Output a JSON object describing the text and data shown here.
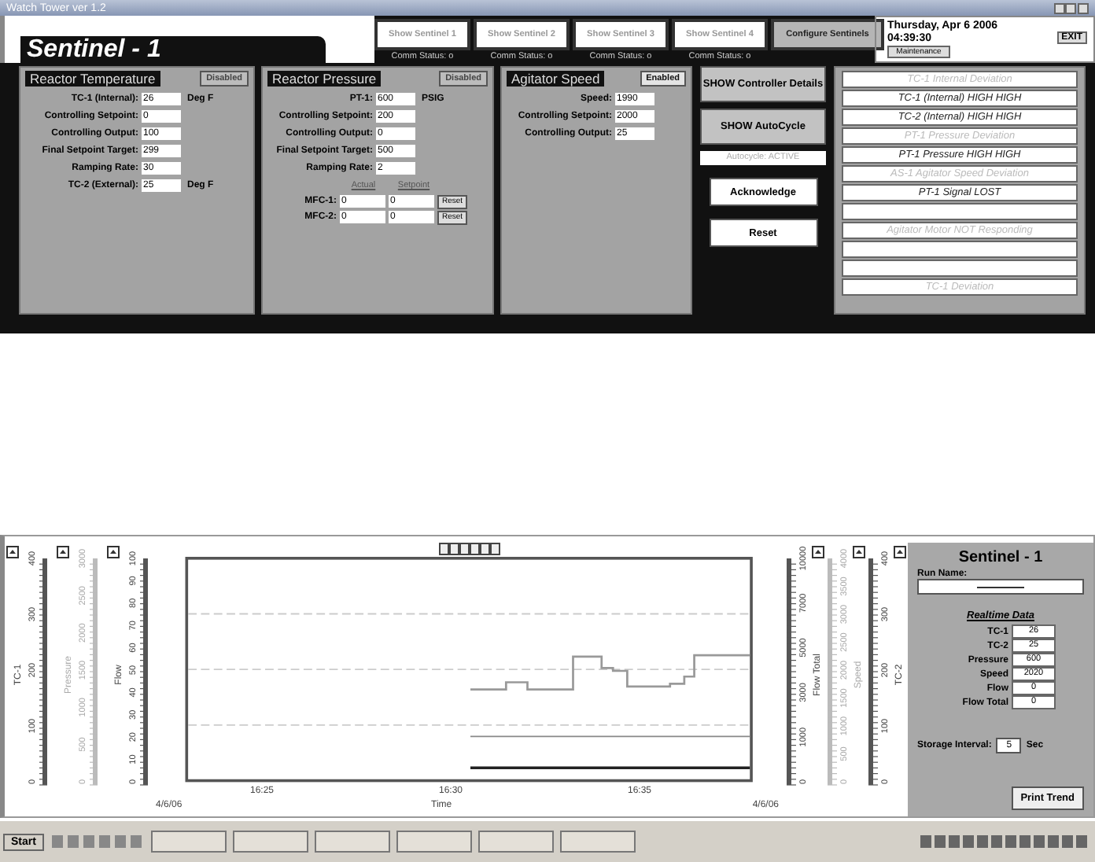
{
  "window": {
    "title": "Watch Tower ver 1.2"
  },
  "sentinel_tab": "Sentinel - 1",
  "sentinel_buttons": [
    {
      "label": "Show Sentinel 1",
      "status": "Comm Status: o",
      "kind": "sentinel"
    },
    {
      "label": "Show Sentinel 2",
      "status": "Comm Status: o",
      "kind": "sentinel"
    },
    {
      "label": "Show Sentinel 3",
      "status": "Comm Status: o",
      "kind": "sentinel"
    },
    {
      "label": "Show Sentinel 4",
      "status": "Comm Status: o",
      "kind": "sentinel"
    },
    {
      "label": "Configure Sentinels",
      "kind": "configure"
    }
  ],
  "clock": {
    "date": "Thursday, Apr 6 2006",
    "time": "04:39:30",
    "exit": "EXIT",
    "maintenance": "Maintenance"
  },
  "panels": [
    {
      "title": "Reactor Temperature",
      "toggle": "Disabled",
      "enabled": false,
      "fields": [
        {
          "label": "TC-1 (Internal):",
          "value": "26",
          "unit": "Deg F"
        },
        {
          "label": "Controlling Setpoint:",
          "value": "0"
        },
        {
          "label": "Controlling Output:",
          "value": "100"
        },
        {
          "label": "Final Setpoint Target:",
          "value": "299"
        },
        {
          "label": "Ramping Rate:",
          "value": "30"
        },
        {
          "label": "TC-2 (External):",
          "value": "25",
          "unit": "Deg F"
        }
      ]
    },
    {
      "title": "Reactor Pressure",
      "toggle": "Disabled",
      "enabled": false,
      "fields": [
        {
          "label": "PT-1:",
          "value": "600",
          "unit": "PSIG"
        },
        {
          "label": "Controlling Setpoint:",
          "value": "200"
        },
        {
          "label": "Controlling Output:",
          "value": "0"
        },
        {
          "label": "Final Setpoint Target:",
          "value": "500"
        },
        {
          "label": "Ramping Rate:",
          "value": "2"
        }
      ],
      "mfc": {
        "headers": [
          "Actual",
          "Setpoint"
        ],
        "rows": [
          {
            "label": "MFC-1:",
            "actual": "0",
            "setpoint": "0",
            "button": "Reset"
          },
          {
            "label": "MFC-2:",
            "actual": "0",
            "setpoint": "0",
            "button": "Reset"
          }
        ]
      }
    },
    {
      "title": "Agitator Speed",
      "toggle": "Enabled",
      "enabled": true,
      "fields": [
        {
          "label": "Speed:",
          "value": "1990"
        },
        {
          "label": "Controlling Setpoint:",
          "value": "2000"
        },
        {
          "label": "Controlling Output:",
          "value": "25"
        }
      ]
    }
  ],
  "controls": {
    "details": "SHOW Controller Details",
    "autocycle": "SHOW AutoCycle",
    "autocycle_status": "Autocycle: ACTIVE",
    "acknowledge": "Acknowledge",
    "reset": "Reset"
  },
  "alarms": [
    {
      "kind": "alarm",
      "text": "TC-1 Internal Deviation",
      "active": false
    },
    {
      "kind": "alarm",
      "text": "TC-1 (Internal) HIGH HIGH",
      "active": true
    },
    {
      "kind": "alarm",
      "text": "TC-2 (Internal) HIGH HIGH",
      "active": true
    },
    {
      "kind": "alarm",
      "text": "PT-1 Pressure Deviation",
      "active": false
    },
    {
      "kind": "alarm",
      "text": "PT-1 Pressure HIGH HIGH",
      "active": true
    },
    {
      "kind": "alarm",
      "text": "AS-1 Agitator Speed Deviation",
      "active": false
    },
    {
      "kind": "alarm",
      "text": "PT-1 Signal LOST",
      "active": true
    },
    {
      "kind": "blank"
    },
    {
      "kind": "alarm",
      "text": "Agitator Motor NOT Responding",
      "active": false
    },
    {
      "kind": "blank"
    },
    {
      "kind": "blank"
    },
    {
      "kind": "alarm",
      "text": "TC-1 Deviation",
      "active": false
    }
  ],
  "trend": {
    "left_axes": [
      {
        "name": "TC-1",
        "ticks": [
          "0",
          "100",
          "200",
          "300",
          "400"
        ],
        "dimmed": false
      },
      {
        "name": "Pressure",
        "ticks": [
          "0",
          "500",
          "1000",
          "1500",
          "2000",
          "2500",
          "3000"
        ],
        "dimmed": true
      },
      {
        "name": "Flow",
        "ticks": [
          "0",
          "10",
          "20",
          "30",
          "40",
          "50",
          "60",
          "70",
          "80",
          "90",
          "100"
        ],
        "dimmed": false
      }
    ],
    "right_axes": [
      {
        "name": "Flow Total",
        "ticks": [
          "0",
          "1000",
          "3000",
          "5000",
          "7000",
          "10000"
        ],
        "dimmed": false
      },
      {
        "name": "Speed",
        "ticks": [
          "0",
          "500",
          "1000",
          "1500",
          "2000",
          "2500",
          "3000",
          "3500",
          "4000"
        ],
        "dimmed": true
      },
      {
        "name": "TC-2",
        "ticks": [
          "0",
          "100",
          "200",
          "300",
          "400"
        ],
        "dimmed": false
      }
    ],
    "x_ticks": [
      "16:25",
      "16:30",
      "16:35"
    ],
    "x_label": "Time",
    "start_date": "4/6/06",
    "end_date": "4/6/06"
  },
  "side": {
    "title": "Sentinel - 1",
    "run_name_label": "Run Name:",
    "realtime_title": "Realtime Data",
    "readings": [
      {
        "label": "TC-1",
        "value": "26"
      },
      {
        "label": "TC-2",
        "value": "25"
      },
      {
        "label": "Pressure",
        "value": "600"
      },
      {
        "label": "Speed",
        "value": "2020"
      },
      {
        "label": "Flow",
        "value": "0"
      },
      {
        "label": "Flow Total",
        "value": "0"
      }
    ],
    "storage_label": "Storage Interval:",
    "storage_value": "5",
    "storage_unit": "Sec",
    "print": "Print Trend"
  },
  "taskbar": {
    "start": "Start"
  }
}
